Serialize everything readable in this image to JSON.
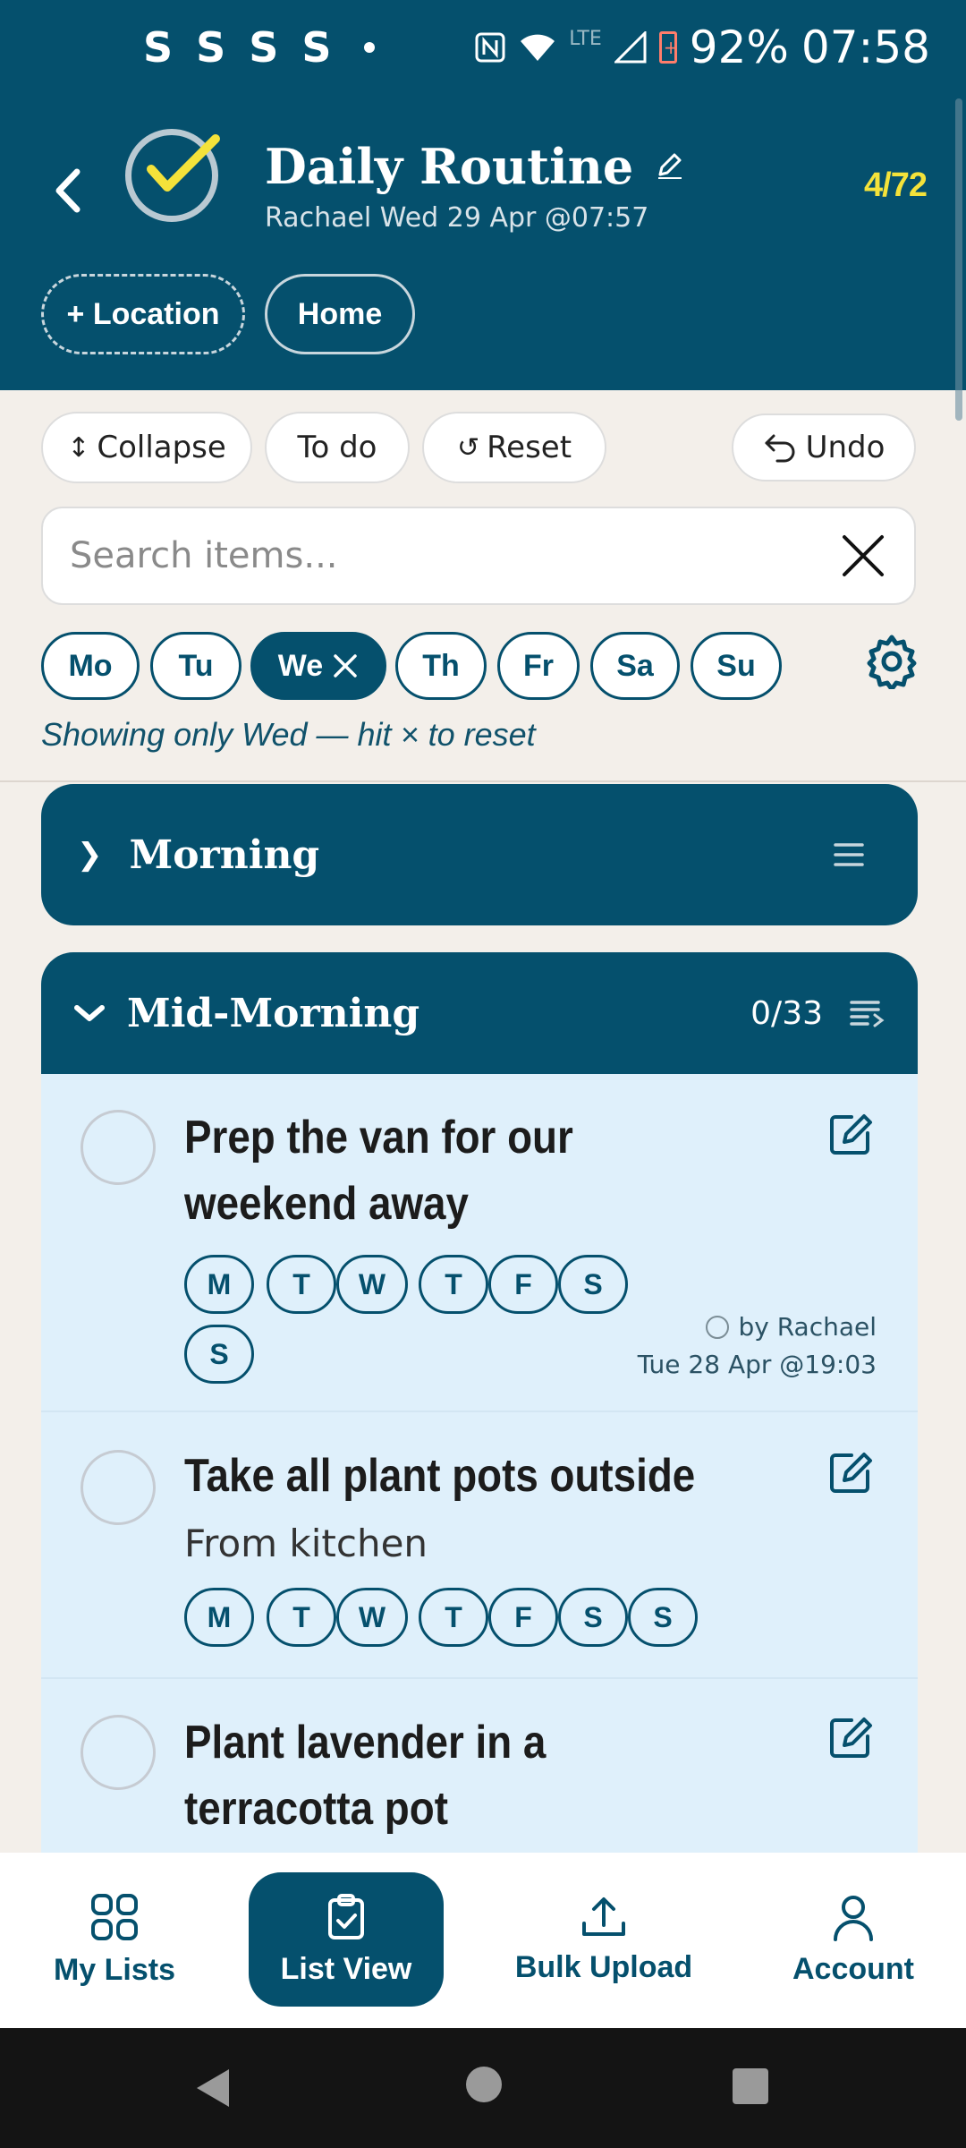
{
  "status_bar": {
    "notifications": [
      "S",
      "S",
      "S",
      "S"
    ],
    "battery": "92%",
    "time": "07:58",
    "network": "LTE"
  },
  "header": {
    "title": "Daily Routine",
    "subtitle": "Rachael Wed 29 Apr @07:57",
    "count": "4/72",
    "location_chip": "+ Location",
    "home_chip": "Home"
  },
  "toolbar": {
    "collapse": "Collapse",
    "collapse_icon": "↕",
    "todo": "To do",
    "reset": "Reset",
    "reset_icon": "↺",
    "undo": "Undo"
  },
  "search": {
    "placeholder": "Search items..."
  },
  "days": [
    {
      "label": "Mo"
    },
    {
      "label": "Tu"
    },
    {
      "label": "We",
      "active": true
    },
    {
      "label": "Th"
    },
    {
      "label": "Fr"
    },
    {
      "label": "Sa"
    },
    {
      "label": "Su"
    }
  ],
  "filter_note": "Showing only Wed — hit × to reset",
  "sections": {
    "morning": {
      "title": "Morning",
      "chevron": "❯"
    },
    "mid_morning": {
      "title": "Mid-Morning",
      "count": "0/33"
    }
  },
  "items": [
    {
      "name": "Prep the van for our weekend away",
      "days": [
        "M",
        "T",
        "W",
        "T",
        "F",
        "S",
        "S"
      ],
      "by": "by Rachael",
      "time": "Tue 28 Apr @19:03"
    },
    {
      "name": "Take all plant pots outside",
      "description": "From kitchen",
      "days": [
        "M",
        "T",
        "W",
        "T",
        "F",
        "S",
        "S"
      ]
    },
    {
      "name": "Plant lavender in a terracotta pot"
    }
  ],
  "bottom_nav": {
    "my_lists": "My Lists",
    "list_view": "List View",
    "bulk_upload": "Bulk Upload",
    "account": "Account"
  },
  "colors": {
    "primary": "#05506d",
    "accent_yellow": "#f4e23a",
    "item_bg": "#dff0fb",
    "page_bg": "#f3efea"
  }
}
